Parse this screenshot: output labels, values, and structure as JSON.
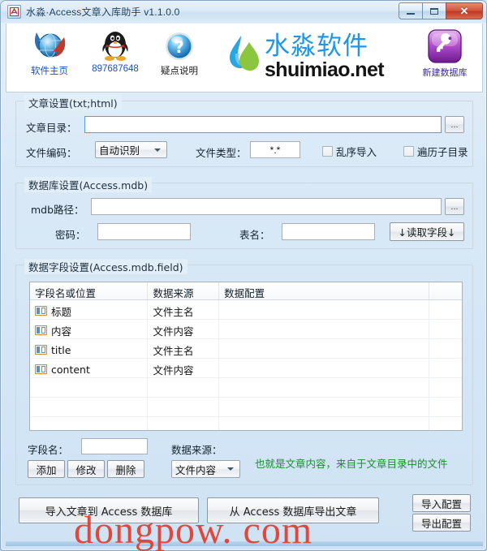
{
  "window": {
    "title": "水淼·Access文章入库助手 v1.1.0.0",
    "icon": "app-icon",
    "buttons": {
      "minimize": "minimize-icon",
      "maximize": "maximize-icon",
      "close": "✕"
    }
  },
  "toolbar": {
    "items": [
      {
        "icon": "globe-icon",
        "label": "软件主页",
        "style": "blue"
      },
      {
        "icon": "qq-penguin-icon",
        "label": "897687648",
        "style": "blue"
      },
      {
        "icon": "help-question-icon",
        "label": "疑点说明",
        "style": "dark"
      },
      {
        "icon": "new-database-icon",
        "label": "新建数据库",
        "style": "purple"
      }
    ],
    "brand": {
      "icon": "water-drop-logo",
      "cn": "水淼软件",
      "en": "shuimiao.net"
    }
  },
  "article_group": {
    "legend": "文章设置(txt;html)",
    "dir_label": "文章目录：",
    "dir_value": "",
    "dir_browse": "...",
    "encoding_label": "文件编码：",
    "encoding_value": "自动识别",
    "filetype_label": "文件类型：",
    "filetype_value": "*.*",
    "checkbox_random": "乱序导入",
    "checkbox_subdirs": "遍历子目录"
  },
  "database_group": {
    "legend": "数据库设置(Access.mdb)",
    "mdb_label": "mdb路径：",
    "mdb_value": "",
    "mdb_browse": "...",
    "password_label": "密码：",
    "password_value": "",
    "table_label": "表名：",
    "table_value": "",
    "read_fields_button": "↓读取字段↓"
  },
  "field_group": {
    "legend": "数据字段设置(Access.mdb.field)",
    "columns": [
      "字段名或位置",
      "数据来源",
      "数据配置",
      ""
    ],
    "rows": [
      {
        "icon": "field-icon",
        "name": "标题",
        "source": "文件主名",
        "config": ""
      },
      {
        "icon": "field-icon",
        "name": "内容",
        "source": "文件内容",
        "config": ""
      },
      {
        "icon": "field-icon",
        "name": "title",
        "source": "文件主名",
        "config": ""
      },
      {
        "icon": "field-icon",
        "name": "content",
        "source": "文件内容",
        "config": ""
      }
    ],
    "fieldname_label": "字段名：",
    "fieldname_value": "",
    "source_label": "数据来源：",
    "source_value": "文件内容",
    "add_button": "添加",
    "edit_button": "修改",
    "delete_button": "删除",
    "hint": "也就是文章内容，来自于文章目录中的文件"
  },
  "actions": {
    "import_button": "导入文章到 Access 数据库",
    "export_button": "从 Access 数据库导出文章",
    "import_config_button": "导入配置",
    "export_config_button": "导出配置"
  },
  "watermark": "dongpow. com",
  "colors": {
    "accent_blue": "#2196e8",
    "link_blue": "#1a4fc4",
    "hint_green": "#1a8a2e",
    "watermark_red": "#e33b2e",
    "close_red": "#bf3a23"
  }
}
